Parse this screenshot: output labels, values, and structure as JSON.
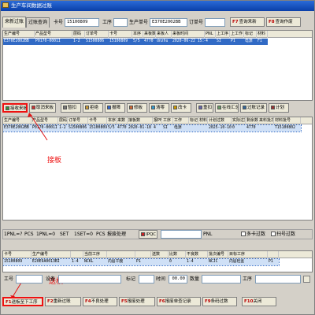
{
  "window": {
    "title": "生产车间数据过账"
  },
  "tabs": [
    "来新过账",
    "过账查询"
  ],
  "top_fields": {
    "card_label": "卡号",
    "card_value": "15100809",
    "process_label": "工序",
    "process_value": "",
    "order_label": "生产单号",
    "order_value": "E370E2002BB",
    "order_num_label": "订单号",
    "order_num_value": "",
    "btn_f7": "F7",
    "btn_f7_label": "查询来新",
    "btn_f8": "F8",
    "btn_f8_label": "查询作废"
  },
  "grid1": {
    "columns": [
      "生产编号",
      "产品型号",
      "层码",
      "订单号",
      "卡号",
      "本序",
      "来板数",
      "来板人",
      "来板时间",
      "PNL",
      "上工序",
      "上工作",
      "标记",
      "材料"
    ],
    "rows": [
      [
        "E370E2002BB",
        "P0170-0001I",
        "1-2",
        "S1500806",
        "15100809",
        "5/5",
        "4770",
        "dnzhu",
        "2020-06-22 15:4",
        "4",
        "SI",
        "P1",
        "电源",
        "F1"
      ]
    ]
  },
  "toolbar": [
    {
      "key": "",
      "label": "接收来板"
    },
    {
      "key": "",
      "label": "取消来板"
    },
    {
      "key": "",
      "label": "暂扣"
    },
    {
      "key": "",
      "label": "拒绝"
    },
    {
      "key": "",
      "label": "报障"
    },
    {
      "key": "",
      "label": "修板"
    },
    {
      "key": "",
      "label": "清零"
    },
    {
      "key": "",
      "label": "改卡"
    },
    {
      "key": "",
      "label": "重扣"
    },
    {
      "key": "",
      "label": "在线汇总"
    },
    {
      "key": "",
      "label": "过账记录"
    },
    {
      "key": "",
      "label": "计划"
    }
  ],
  "grid2": {
    "columns": [
      "生产编号",
      "产品型号",
      "层码",
      "订单号",
      "卡号",
      "本序",
      "来数",
      "接板数",
      "报PNL",
      "工序",
      "工作",
      "标记",
      "材料",
      "计划过数",
      "实际过数",
      "剩余数",
      "来料批次",
      "材料批号"
    ],
    "rows": [
      [
        "E370E2002BB",
        "P0170-0001I",
        "1-2",
        "S1500806",
        "15100809",
        "5/5",
        "4770",
        "2020-01-18",
        "4",
        "SI",
        "电源",
        "",
        "",
        "2025-10-10",
        "0",
        "4770",
        "",
        "T15100802"
      ]
    ]
  },
  "annotations": {
    "receive": "接板",
    "deliver": "送板"
  },
  "pnl_bar": {
    "pnl1": "1PNL=?",
    "pcs1": "PCS",
    "pnl2": "1PNL=0",
    "set": "SET",
    "set2": "1SET=0",
    "pcs2": "PCS",
    "label_resp": "报废处理",
    "ipqc": "IPQC",
    "pnl_label": "PNL",
    "chk1": "多卡过数",
    "chk2": "扫号过数"
  },
  "grid3": {
    "columns": [
      "卡号",
      "生产编号",
      "",
      "当前工序",
      "",
      "",
      "送数",
      "比数",
      "不良数",
      "批次编号",
      "目标工序",
      ""
    ],
    "rows": [
      [
        "15100809",
        "E20E9A0013BI",
        "1-4",
        "NCKL",
        "内层干膜",
        "P1",
        "",
        "0",
        "1-4",
        "NCJC",
        "内层检查",
        "P1"
      ]
    ]
  },
  "bottom_fields": {
    "process_label": "工号",
    "device_label": "设备",
    "mark_label": "标记",
    "time_label": "时间",
    "time_value": "00.00",
    "qty_label": "数量",
    "work_label": "工序"
  },
  "function_keys": [
    {
      "key": "F1",
      "label": "送板至下工序"
    },
    {
      "key": "F2",
      "label": "重新过账"
    },
    {
      "key": "F4",
      "label": "不良处理"
    },
    {
      "key": "F5",
      "label": "报废处理"
    },
    {
      "key": "F6",
      "label": "报废单查记录"
    },
    {
      "key": "F9",
      "label": "条码过数"
    },
    {
      "key": "F10",
      "label": "关闭"
    }
  ],
  "colors": {
    "selection": "#316ac5",
    "annotation": "#e11111",
    "titlebar": "#0a3fa8"
  }
}
